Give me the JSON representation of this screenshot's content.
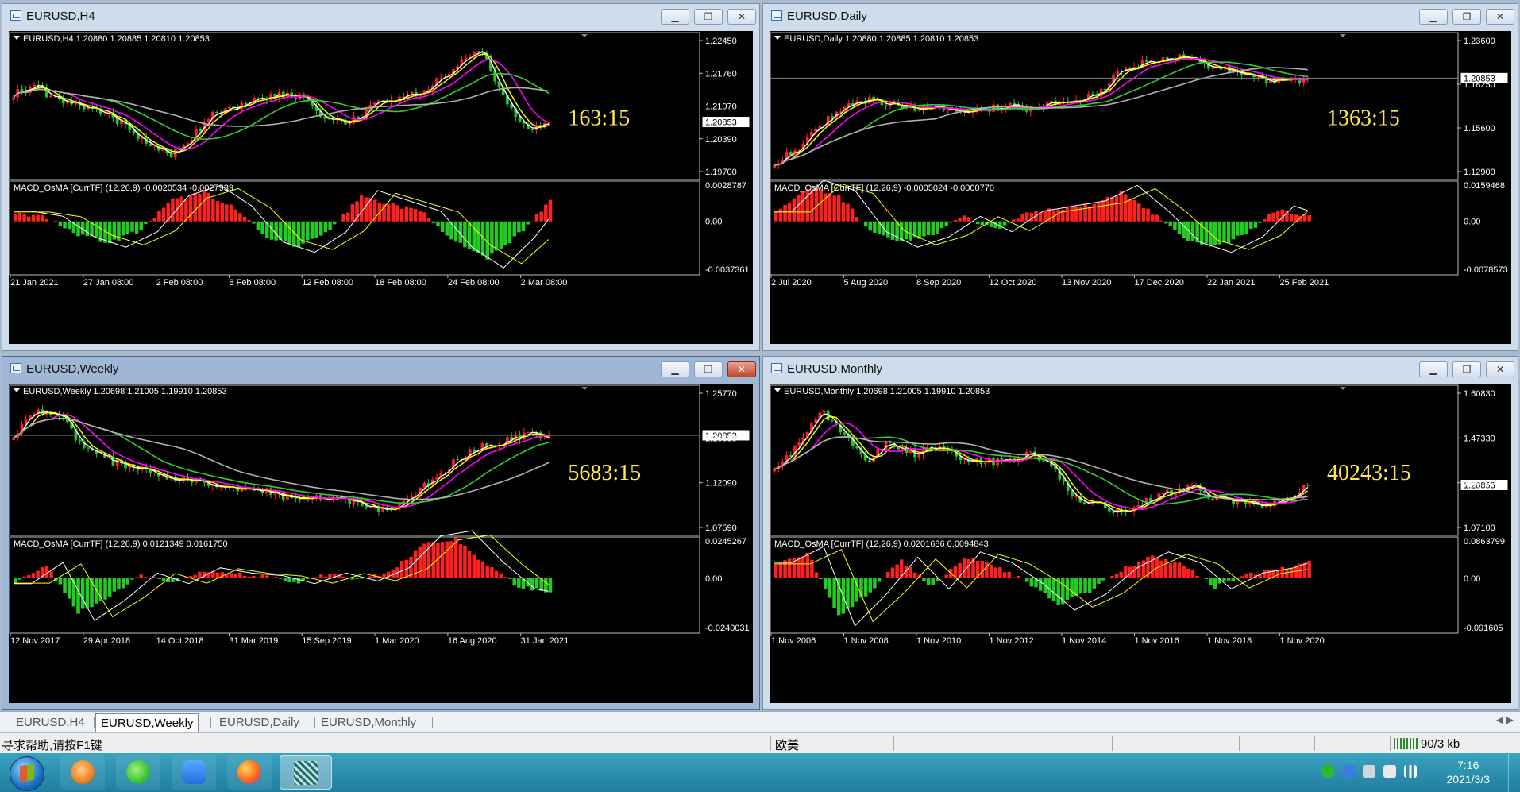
{
  "app": "MetaTrader",
  "windows": [
    {
      "id": "h4",
      "title": "EURUSD,H4",
      "active": false,
      "header": "EURUSD,H4  1.20880 1.20885 1.20810 1.20853",
      "big_label": "163:15",
      "current_price": "1.20853",
      "price_ticks": [
        "1.22450",
        "1.21760",
        "1.21070",
        "1.20390",
        "1.19700"
      ],
      "indicator": "MACD_OsMA [CurrTF] (12,26,9) -0.0020534 -0.0027939",
      "ind_ticks": [
        "0.0028787",
        "0.00",
        "-0.0037361"
      ],
      "time_ticks": [
        "21 Jan 2021",
        "27 Jan 08:00",
        "2 Feb 08:00",
        "8 Feb 08:00",
        "12 Feb 08:00",
        "18 Feb 08:00",
        "24 Feb 08:00",
        "2 Mar 08:00"
      ]
    },
    {
      "id": "daily",
      "title": "EURUSD,Daily",
      "active": false,
      "header": "EURUSD,Daily  1.20880 1.20885 1.20810 1.20853",
      "big_label": "1363:15",
      "current_price": "1.20853",
      "price_ticks": [
        "1.23600",
        "1.18250",
        "1.15600",
        "1.12900"
      ],
      "indicator": "MACD_OsMA [CurrTF] (12,26,9) -0.0005024 -0.0000770",
      "ind_ticks": [
        "0.0159468",
        "0.00",
        "-0.0078573"
      ],
      "time_ticks": [
        "2 Jul 2020",
        "5 Aug 2020",
        "8 Sep 2020",
        "12 Oct 2020",
        "13 Nov 2020",
        "17 Dec 2020",
        "22 Jan 2021",
        "25 Feb 2021"
      ]
    },
    {
      "id": "weekly",
      "title": "EURUSD,Weekly",
      "active": true,
      "header": "EURUSD,Weekly  1.20698 1.21005 1.19910 1.20853",
      "big_label": "5683:15",
      "current_price": "1.20853",
      "price_ticks": [
        "1.25770",
        "1.16680",
        "1.12090",
        "1.07590"
      ],
      "indicator": "MACD_OsMA [CurrTF] (12,26,9) 0.0121349 0.0161750",
      "ind_ticks": [
        "0.0245267",
        "0.00",
        "-0.0240031"
      ],
      "time_ticks": [
        "12 Nov 2017",
        "29 Apr 2018",
        "14 Oct 2018",
        "31 Mar 2019",
        "15 Sep 2019",
        "1 Mar 2020",
        "16 Aug 2020",
        "31 Jan 2021"
      ]
    },
    {
      "id": "monthly",
      "title": "EURUSD,Monthly",
      "active": false,
      "header": "EURUSD,Monthly  1.20698 1.21005 1.19910 1.20853",
      "big_label": "40243:15",
      "current_price": "1.20853",
      "price_ticks": [
        "1.60830",
        "1.47330",
        "1.34100",
        "1.07100"
      ],
      "indicator": "MACD_OsMA [CurrTF] (12,26,9) 0.0201686 0.0094843",
      "ind_ticks": [
        "0.0863799",
        "0.00",
        "-0.091605"
      ],
      "time_ticks": [
        "1 Nov 2006",
        "1 Nov 2008",
        "1 Nov 2010",
        "1 Nov 2012",
        "1 Nov 2014",
        "1 Nov 2016",
        "1 Nov 2018",
        "1 Nov 2020"
      ]
    }
  ],
  "tabs": [
    "EURUSD,H4",
    "EURUSD,Weekly",
    "EURUSD,Daily",
    "EURUSD,Monthly"
  ],
  "selected_tab": "EURUSD,Weekly",
  "status": {
    "help": "寻求帮助,请按F1键",
    "profile": "欧美",
    "traffic": "90/3 kb"
  },
  "clock": {
    "time": "7:16",
    "date": "2021/3/3"
  },
  "colors": {
    "chart_bg": "#000000",
    "bull_candle": "#ff2020",
    "bear_candle": "#22cc22",
    "label_yellow": "#ffe94a",
    "ma_white": "#ffffff",
    "ma_yellow": "#ffff00",
    "ma_magenta": "#ff00ff",
    "ma_green": "#32cd32",
    "ma_gray": "#b0b0b0"
  },
  "icons": [
    "minimize-icon",
    "restore-icon",
    "close-icon",
    "chart-window-icon",
    "windows-start-icon",
    "wechat-icon",
    "firefox-icon",
    "show-desktop-icon"
  ]
}
